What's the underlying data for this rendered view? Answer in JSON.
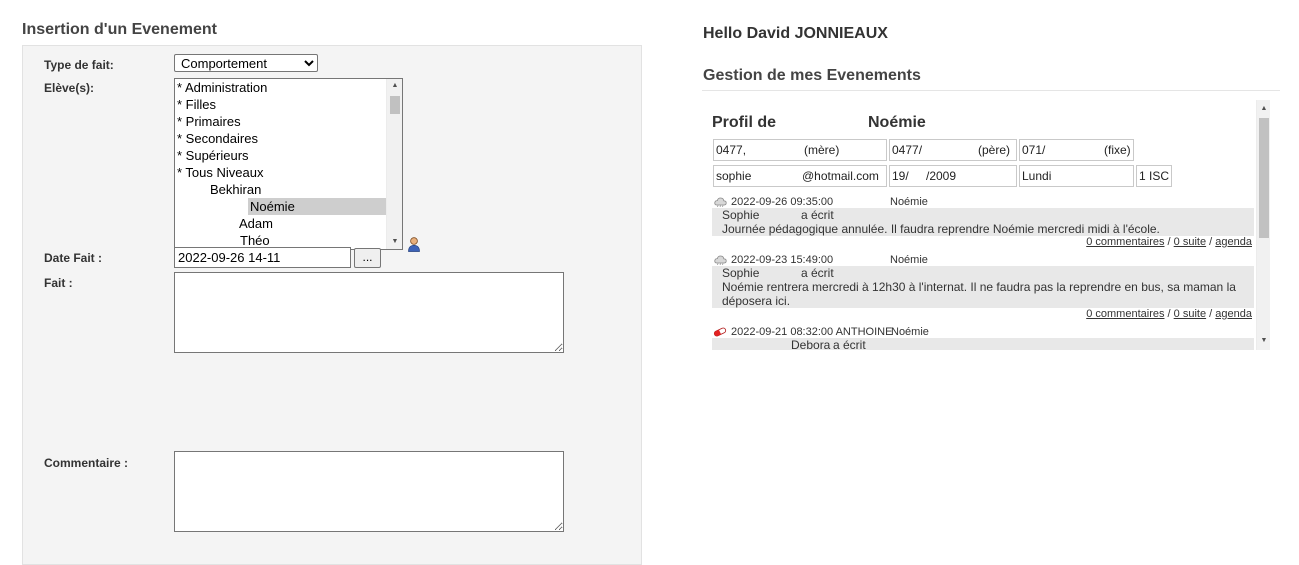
{
  "form": {
    "title": "Insertion d'un Evenement",
    "type_label": "Type de fait:",
    "type_value": "Comportement",
    "eleves_label": "Elève(s):",
    "eleves_items": [
      "* Administration",
      "* Filles",
      "* Primaires",
      "* Secondaires",
      "* Supérieurs",
      "* Tous Niveaux",
      "Bekhiran",
      "Noémie",
      "Adam",
      "Théo"
    ],
    "selected_item": "Noémie",
    "date_label": "Date Fait :",
    "date_value": "2022-09-26 14-11",
    "date_button": "...",
    "fait_label": "Fait :",
    "commentaire_label": "Commentaire :",
    "person_icon": "person-icon"
  },
  "right": {
    "hello": "Hello David JONNIEAUX",
    "gestion_title": "Gestion de mes Evenements",
    "profile": {
      "title_prefix": "Profil de",
      "title_name": "Noémie",
      "row1": [
        "0477,",
        "(mère)",
        "0477/",
        "(père)",
        "071/",
        "(fixe)"
      ],
      "row2": [
        "sophie",
        "@hotmail.com",
        "19/",
        "/2009",
        "Lundi",
        "1 ISC"
      ]
    },
    "events": [
      {
        "icon": "cloud-icon",
        "datetime": "2022-09-26 09:35:00",
        "student": "Noémie",
        "author": "Sophie",
        "wrote": "a écrit",
        "text": "Journée pédagogique annulée. Il faudra reprendre Noémie mercredi midi à l'école.",
        "links": [
          "0 commentaires",
          "0 suite",
          "agenda"
        ]
      },
      {
        "icon": "cloud-icon",
        "datetime": "2022-09-23 15:49:00",
        "student": "Noémie",
        "author": "Sophie",
        "wrote": "a écrit",
        "text": "Noémie rentrera mercredi à 12h30 à l'internat. Il ne faudra pas la reprendre en bus, sa maman la déposera ici.",
        "links": [
          "0 commentaires",
          "0 suite",
          "agenda"
        ]
      },
      {
        "icon": "pill-icon",
        "datetime": "2022-09-21 08:32:00 ANTHOINE",
        "student": "Noémie",
        "author": "Debora",
        "wrote": "a écrit"
      }
    ],
    "link_sep": "/"
  },
  "colors": {
    "panel_bg": "#f4f4f4",
    "event_bg": "#e8e8e8",
    "selected_bg": "#cecece"
  }
}
